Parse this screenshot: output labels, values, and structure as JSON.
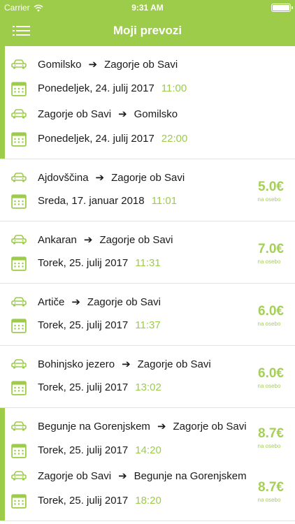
{
  "status": {
    "carrier": "Carrier",
    "time": "9:31 AM"
  },
  "nav": {
    "title": "Moji prevozi"
  },
  "colors": {
    "accent": "#9ccc4a",
    "price": "#a5cf58"
  },
  "rides": [
    {
      "from": "Gomilsko",
      "to": "Zagorje ob Savi",
      "date": "Ponedeljek, 24. julij 2017",
      "time": "11:00",
      "return_from": "Zagorje ob Savi",
      "return_to": "Gomilsko",
      "return_date": "Ponedeljek, 24. julij 2017",
      "return_time": "22:00"
    },
    {
      "from": "Ajdovščina",
      "to": "Zagorje ob Savi",
      "date": "Sreda, 17. januar 2018",
      "time": "11:01",
      "price": "5.0€",
      "price_unit": "na osebo"
    },
    {
      "from": "Ankaran",
      "to": "Zagorje ob Savi",
      "date": "Torek, 25. julij 2017",
      "time": "11:31",
      "price": "7.0€",
      "price_unit": "na osebo"
    },
    {
      "from": "Artiče",
      "to": "Zagorje ob Savi",
      "date": "Torek, 25. julij 2017",
      "time": "11:37",
      "price": "6.0€",
      "price_unit": "na osebo"
    },
    {
      "from": "Bohinjsko jezero",
      "to": "Zagorje ob Savi",
      "date": "Torek, 25. julij 2017",
      "time": "13:02",
      "price": "6.0€",
      "price_unit": "na osebo"
    },
    {
      "from": "Begunje na Gorenjskem",
      "to": "Zagorje ob Savi",
      "date": "Torek, 25. julij 2017",
      "time": "14:20",
      "price": "8.7€",
      "price_unit": "na osebo",
      "return_from": "Zagorje ob Savi",
      "return_to": "Begunje na Gorenjskem",
      "return_date": "Torek, 25. julij 2017",
      "return_time": "18:20",
      "return_price": "8.7€",
      "return_price_unit": "na osebo"
    }
  ]
}
